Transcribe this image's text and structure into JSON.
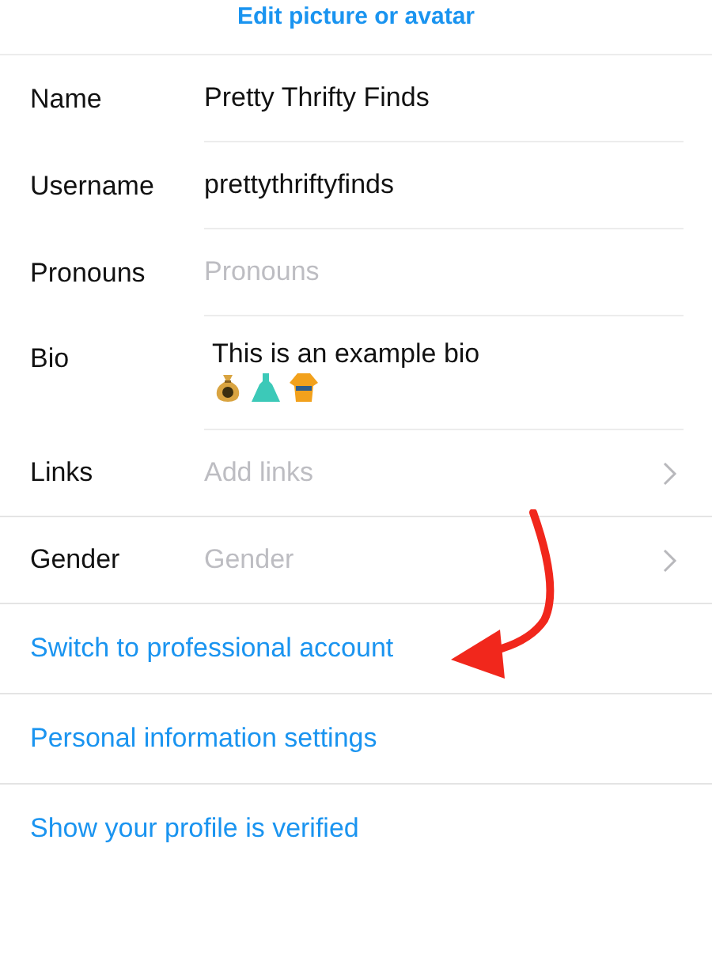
{
  "header": {
    "link": "Edit picture or avatar"
  },
  "fields": [
    {
      "kind": "text",
      "label": "Name",
      "value": "Pretty Thrifty Finds",
      "chevron": false
    },
    {
      "kind": "text",
      "label": "Username",
      "value": "prettythriftyfinds",
      "chevron": false
    },
    {
      "kind": "text",
      "label": "Pronouns",
      "placeholder": "Pronouns",
      "chevron": false
    },
    {
      "kind": "bio",
      "label": "Bio",
      "value": "This is an example bio",
      "chevron": false
    },
    {
      "kind": "text",
      "label": "Links",
      "placeholder": "Add links",
      "chevron": true
    },
    {
      "kind": "text",
      "label": "Gender",
      "placeholder": "Gender",
      "chevron": true
    }
  ],
  "links": [
    "Switch to professional account",
    "Personal information settings",
    "Show your profile is verified"
  ]
}
